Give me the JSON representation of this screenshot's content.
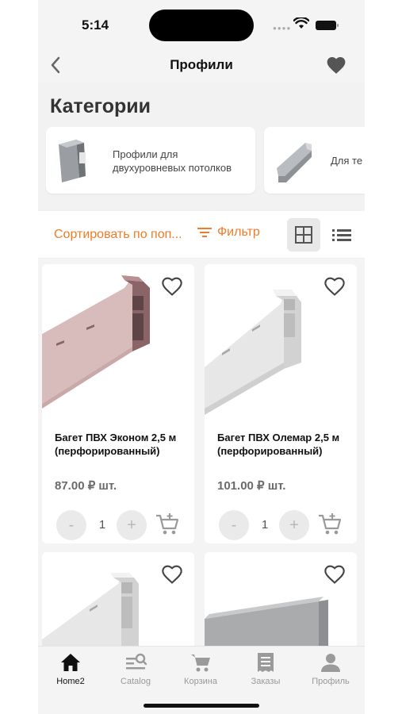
{
  "status_bar": {
    "time": "5:14"
  },
  "header": {
    "title": "Профили",
    "back_icon": "chevron-left-icon",
    "favorite_icon": "heart-filled-icon"
  },
  "categories": {
    "heading": "Категории",
    "items": [
      {
        "label": "Профили для двухуровневых потолков"
      },
      {
        "label": "Для те"
      }
    ]
  },
  "toolbar": {
    "sort_label": "Сортировать по поп...",
    "filter_label": "Фильтр",
    "accent_color": "#f07c27"
  },
  "products": [
    {
      "name": "Багет ПВХ Эконом 2,5 м (перфорированный)",
      "price": "87.00 ₽ шт.",
      "quantity": "1",
      "minus": "-",
      "plus": "+"
    },
    {
      "name": "Багет ПВХ Олемар 2,5 м (перфорированный)",
      "price": "101.00 ₽ шт.",
      "quantity": "1",
      "minus": "-",
      "plus": "+"
    },
    {
      "name": "",
      "price": "",
      "quantity": ""
    },
    {
      "name": "",
      "price": "",
      "quantity": ""
    }
  ],
  "tabs": [
    {
      "label": "Home2",
      "icon": "home-icon",
      "active": true
    },
    {
      "label": "Catalog",
      "icon": "catalog-search-icon",
      "active": false
    },
    {
      "label": "Корзина",
      "icon": "cart-icon",
      "active": false
    },
    {
      "label": "Заказы",
      "icon": "receipt-icon",
      "active": false
    },
    {
      "label": "Профиль",
      "icon": "person-icon",
      "active": false
    }
  ]
}
